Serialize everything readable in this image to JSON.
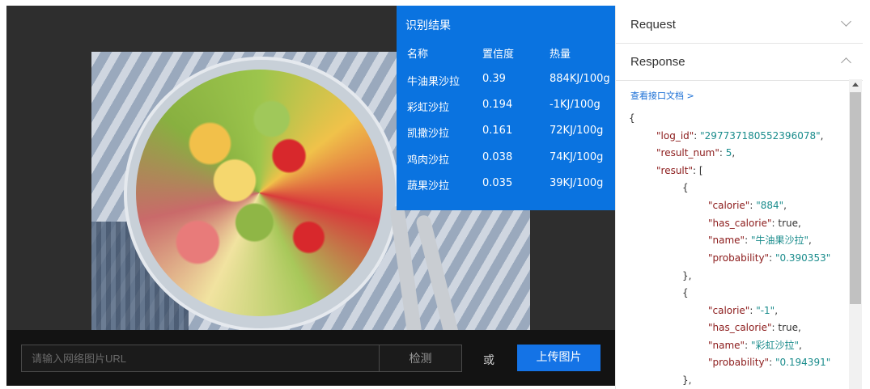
{
  "result": {
    "title": "识别结果",
    "headers": {
      "name": "名称",
      "confidence": "置信度",
      "calorie": "热量"
    },
    "rows": [
      {
        "name": "牛油果沙拉",
        "confidence": "0.39",
        "calorie": "884KJ/100g"
      },
      {
        "name": "彩虹沙拉",
        "confidence": "0.194",
        "calorie": "-1KJ/100g"
      },
      {
        "name": "凯撒沙拉",
        "confidence": "0.161",
        "calorie": "72KJ/100g"
      },
      {
        "name": "鸡肉沙拉",
        "confidence": "0.038",
        "calorie": "74KJ/100g"
      },
      {
        "name": "蔬果沙拉",
        "confidence": "0.035",
        "calorie": "39KJ/100g"
      }
    ]
  },
  "input": {
    "placeholder": "请输入网络图片URL",
    "detect_label": "检测",
    "or_text": "或",
    "upload_label": "上传图片"
  },
  "panel": {
    "request_label": "Request",
    "response_label": "Response",
    "doc_link": "查看接口文档 >"
  },
  "json": {
    "open_brace": "{",
    "log_id_key": "\"log_id\"",
    "log_id_val": "\"297737180552396078\"",
    "result_num_key": "\"result_num\"",
    "result_num_val": "5",
    "result_key": "\"result\"",
    "open_bracket": "[",
    "item1": {
      "open": "{",
      "calorie_key": "\"calorie\"",
      "calorie_val": "\"884\"",
      "has_calorie_key": "\"has_calorie\"",
      "has_calorie_val": "true",
      "name_key": "\"name\"",
      "name_val": "\"牛油果沙拉\"",
      "probability_key": "\"probability\"",
      "probability_val": "\"0.390353\"",
      "close": "},"
    },
    "item2": {
      "open": "{",
      "calorie_key": "\"calorie\"",
      "calorie_val": "\"-1\"",
      "has_calorie_key": "\"has_calorie\"",
      "has_calorie_val": "true",
      "name_key": "\"name\"",
      "name_val": "\"彩虹沙拉\"",
      "probability_key": "\"probability\"",
      "probability_val": "\"0.194391\"",
      "close": "},"
    }
  },
  "colors": {
    "result_bg": "#0a73e0",
    "upload_btn": "#1473e6",
    "json_key": "#8b1a1a",
    "json_value": "#1a8c8c",
    "link": "#1a6fd6"
  },
  "icons": [
    "chevron-down-icon",
    "chevron-up-icon",
    "scroll-up-arrow-icon"
  ]
}
